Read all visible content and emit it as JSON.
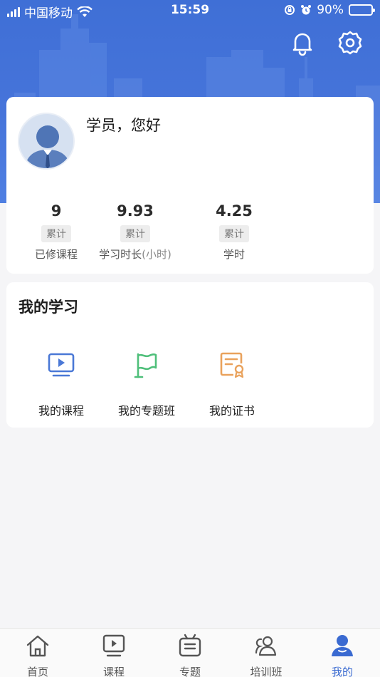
{
  "status_bar": {
    "carrier": "中国移动",
    "time": "15:59",
    "battery": "90%",
    "battery_level": 0.9
  },
  "header": {
    "icons": [
      "bell-icon",
      "settings-gear-icon"
    ]
  },
  "profile": {
    "greeting": "学员，您好",
    "stats": [
      {
        "value": "9",
        "tag": "累计",
        "label": "已修课程",
        "unit": ""
      },
      {
        "value": "9.93",
        "tag": "累计",
        "label": "学习时长",
        "unit": "(小时)"
      },
      {
        "value": "4.25",
        "tag": "累计",
        "label": "学时",
        "unit": ""
      }
    ]
  },
  "learning": {
    "title": "我的学习",
    "items": [
      {
        "label": "我的课程",
        "icon": "video-course-icon",
        "color": "#4a78d6"
      },
      {
        "label": "我的专题班",
        "icon": "flag-icon",
        "color": "#4fbf7a"
      },
      {
        "label": "我的证书",
        "icon": "certificate-icon",
        "color": "#e9a25c"
      }
    ]
  },
  "tabbar": {
    "tabs": [
      {
        "label": "首页",
        "icon": "home-icon"
      },
      {
        "label": "课程",
        "icon": "play-course-icon"
      },
      {
        "label": "专题",
        "icon": "topic-icon"
      },
      {
        "label": "培训班",
        "icon": "training-class-icon"
      },
      {
        "label": "我的",
        "icon": "profile-icon"
      }
    ],
    "active_index": 4,
    "active_color": "#3a6ad1"
  }
}
